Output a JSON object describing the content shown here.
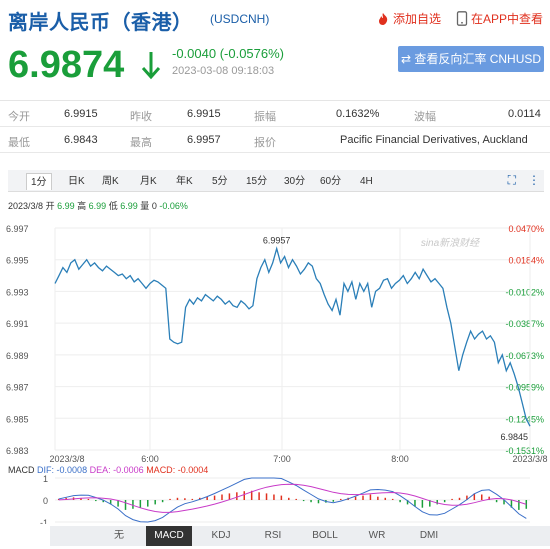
{
  "header": {
    "title": "离岸人民币（香港）",
    "code": "(USDCNH)",
    "fav_label": "添加自选",
    "app_label": "在APP中查看"
  },
  "quote": {
    "price": "6.9874",
    "change": "-0.0040 (-0.0576%)",
    "time": "2023-03-08 09:18:03",
    "reverse_button": "查看反向汇率 CNHUSD",
    "colors": {
      "down": "#1a9e3a",
      "up": "#e0301e",
      "accent": "#1a5ea8"
    }
  },
  "stats": [
    [
      {
        "label": "今开",
        "value": "6.9915"
      },
      {
        "label": "昨收",
        "value": "6.9915"
      },
      {
        "label": "振幅",
        "value": "0.1632%"
      },
      {
        "label": "波幅",
        "value": "0.0114"
      }
    ],
    [
      {
        "label": "最低",
        "value": "6.9843"
      },
      {
        "label": "最高",
        "value": "6.9957"
      },
      {
        "label": "报价",
        "value": "Pacific Financial Derivatives, Auckland"
      }
    ]
  ],
  "tabs": [
    "1分",
    "日K",
    "周K",
    "月K",
    "年K",
    "5分",
    "15分",
    "30分",
    "60分",
    "4H"
  ],
  "active_tab": "1分",
  "info_line": {
    "date": "2023/3/8",
    "open_label": "开",
    "open": "6.99",
    "high_label": "高",
    "high": "6.99",
    "low_label": "低",
    "low": "6.99",
    "volume_label": "量",
    "volume": "0",
    "pct": "-0.06%"
  },
  "chart_data": {
    "type": "line",
    "y_ticks_left": [
      "6.997",
      "6.995",
      "6.993",
      "6.991",
      "6.989",
      "6.987",
      "6.985",
      "6.983"
    ],
    "y_ticks_right": [
      {
        "text": "0.0470%",
        "color": "#e0301e"
      },
      {
        "text": "0.0184%",
        "color": "#e0301e"
      },
      {
        "text": "-0.0102%",
        "color": "#1a9e3a"
      },
      {
        "text": "-0.0387%",
        "color": "#1a9e3a"
      },
      {
        "text": "-0.0673%",
        "color": "#1a9e3a"
      },
      {
        "text": "-0.0959%",
        "color": "#1a9e3a"
      },
      {
        "text": "-0.1245%",
        "color": "#1a9e3a"
      },
      {
        "text": "-0.1531%",
        "color": "#1a9e3a"
      }
    ],
    "x_ticks": [
      "2023/3/8",
      "6:00",
      "7:00",
      "8:00",
      "2023/3/8"
    ],
    "ylim": [
      6.983,
      6.997
    ],
    "high_marker": "6.9957",
    "last_marker": "6.9845",
    "watermark": "sina新浪财经",
    "values": [
      6.9935,
      6.994,
      6.9945,
      6.9942,
      6.9948,
      6.995,
      6.9944,
      6.9947,
      6.995,
      6.9946,
      6.9948,
      6.9945,
      6.9943,
      6.9946,
      6.9944,
      6.9942,
      6.994,
      6.9941,
      6.9938,
      6.994,
      6.9936,
      6.9938,
      6.9935,
      6.9932,
      6.9935,
      6.9937,
      6.9936,
      6.9934,
      6.9932,
      6.99,
      6.9898,
      6.9897,
      6.9898,
      6.992,
      6.9925,
      6.9922,
      6.9926,
      6.9924,
      6.9928,
      6.9926,
      6.9924,
      6.9927,
      6.9925,
      6.9922,
      6.9924,
      6.9921,
      6.992,
      6.9924,
      6.9922,
      6.9919,
      6.9921,
      6.9938,
      6.9945,
      6.995,
      6.9942,
      6.9948,
      6.9957,
      6.9948,
      6.9952,
      6.9945,
      6.995,
      6.9946,
      6.9941,
      6.9944,
      6.9948,
      6.9946,
      6.9938,
      6.9935,
      6.9928,
      6.9922,
      6.9918,
      6.9925,
      6.9915,
      6.9935,
      6.993,
      6.9936,
      6.9925,
      6.9935,
      6.993,
      6.9935,
      6.992,
      6.993,
      6.9932,
      6.9937,
      6.9938,
      6.9932,
      6.9935,
      6.9937,
      6.994,
      6.9935,
      6.9938,
      6.9942,
      6.9938,
      6.9944,
      6.994,
      6.9936,
      6.9938,
      6.9935,
      6.9932,
      6.992,
      6.991,
      6.9895,
      6.988,
      6.989,
      6.9898,
      6.9905,
      6.99,
      6.9903,
      6.9905,
      6.99,
      6.9902,
      6.9898,
      6.9885,
      6.989,
      6.988,
      6.9885,
      6.9878,
      6.987,
      6.986,
      6.985,
      6.9845
    ]
  },
  "macd": {
    "title": "MACD",
    "dif_label": "DIF",
    "dif": "-0.0008",
    "dea_label": "DEA",
    "dea": "-0.0006",
    "macd_label": "MACD",
    "macd": "-0.0004",
    "y_ticks": [
      "1",
      "0",
      "-1"
    ],
    "bars": [
      0.05,
      0.1,
      0.12,
      0.08,
      0.05,
      -0.05,
      -0.1,
      -0.2,
      -0.3,
      -0.45,
      -0.4,
      -0.35,
      -0.3,
      -0.2,
      -0.1,
      0.05,
      0.1,
      0.08,
      0.05,
      0.1,
      0.15,
      0.2,
      0.25,
      0.3,
      0.35,
      0.4,
      0.42,
      0.35,
      0.3,
      0.25,
      0.2,
      0.1,
      0.05,
      -0.05,
      -0.1,
      -0.15,
      -0.12,
      -0.08,
      0.05,
      0.1,
      0.15,
      0.2,
      0.25,
      0.15,
      0.1,
      0.05,
      -0.1,
      -0.2,
      -0.3,
      -0.35,
      -0.3,
      -0.2,
      -0.1,
      0.05,
      0.1,
      0.2,
      0.3,
      0.25,
      0.15,
      -0.1,
      -0.2,
      -0.35,
      -0.45,
      -0.4
    ]
  },
  "bottom_tabs": [
    "无",
    "MACD",
    "KDJ",
    "RSI",
    "BOLL",
    "WR",
    "DMI"
  ],
  "active_bottom_tab": "MACD"
}
